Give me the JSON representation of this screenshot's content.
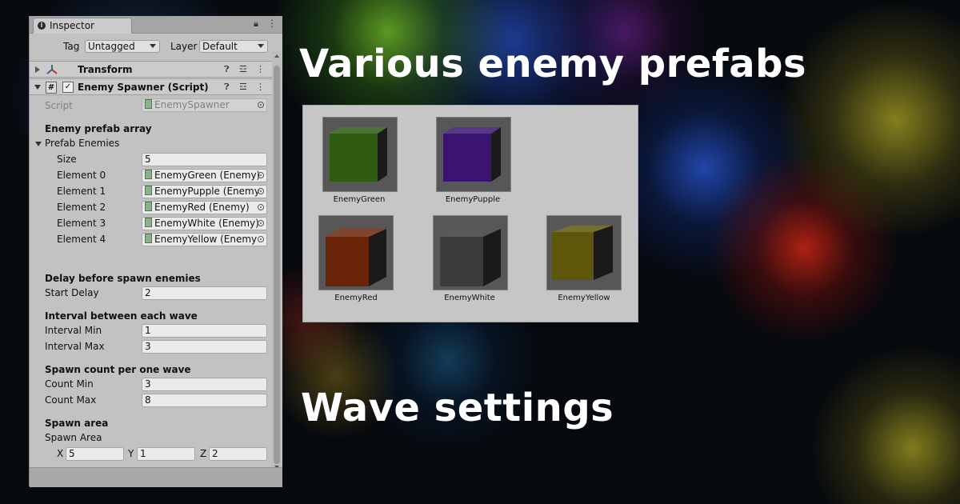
{
  "inspector": {
    "tab_label": "Inspector",
    "tag_label": "Tag",
    "tag_value": "Untagged",
    "layer_label": "Layer",
    "layer_value": "Default",
    "transform": {
      "title": "Transform"
    },
    "spawner": {
      "title": "Enemy Spawner (Script)",
      "enabled": true,
      "script_label": "Script",
      "script_value": "EnemySpawner",
      "prefab_section": "Enemy prefab array",
      "prefab_list_label": "Prefab Enemies",
      "size_label": "Size",
      "size_value": "5",
      "elements": [
        {
          "label": "Element 0",
          "value": "EnemyGreen (Enemy)"
        },
        {
          "label": "Element 1",
          "value": "EnemyPupple (Enemy"
        },
        {
          "label": "Element 2",
          "value": "EnemyRed (Enemy)"
        },
        {
          "label": "Element 3",
          "value": "EnemyWhite (Enemy)"
        },
        {
          "label": "Element 4",
          "value": "EnemyYellow (Enemy"
        }
      ],
      "delay_section": "Delay before spawn enemies",
      "start_delay_label": "Start Delay",
      "start_delay_value": "2",
      "interval_section": "Interval between each wave",
      "interval_min_label": "Interval Min",
      "interval_min_value": "1",
      "interval_max_label": "Interval Max",
      "interval_max_value": "3",
      "count_section": "Spawn count per one wave",
      "count_min_label": "Count Min",
      "count_min_value": "3",
      "count_max_label": "Count Max",
      "count_max_value": "8",
      "area_section": "Spawn area",
      "area_label": "Spawn Area",
      "area_x_label": "X",
      "area_x_value": "5",
      "area_y_label": "Y",
      "area_y_value": "1",
      "area_z_label": "Z",
      "area_z_value": "2"
    }
  },
  "headings": {
    "prefabs": "Various enemy prefabs",
    "waves": "Wave settings"
  },
  "prefabs": [
    {
      "name": "EnemyGreen",
      "color": "#2e5a12"
    },
    {
      "name": "EnemyPupple",
      "color": "#3a1470"
    },
    {
      "name": "EnemyRed",
      "color": "#6a2408"
    },
    {
      "name": "EnemyWhite",
      "color": "#3c3c3c"
    },
    {
      "name": "EnemyYellow",
      "color": "#5e560a"
    }
  ]
}
